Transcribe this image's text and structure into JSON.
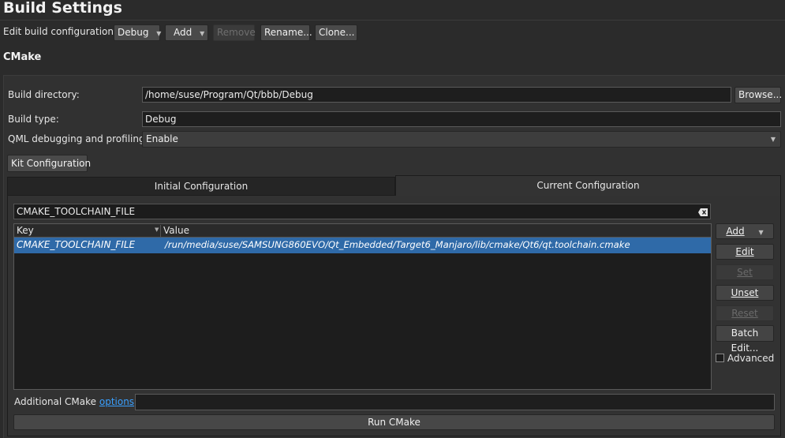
{
  "page_title": "Build Settings",
  "config_row": {
    "label": "Edit build configuration:",
    "config_value": "Debug",
    "add_label": "Add",
    "remove_label": "Remove",
    "rename_label": "Rename...",
    "clone_label": "Clone..."
  },
  "section_title": "CMake",
  "form": {
    "build_dir_label": "Build directory:",
    "build_dir_value": "/home/suse/Program/Qt/bbb/Debug",
    "browse_label": "Browse...",
    "build_type_label": "Build type:",
    "build_type_value": "Debug",
    "qml_label": "QML debugging and profiling:",
    "qml_value": "Enable",
    "kit_config_label": "Kit Configuration"
  },
  "tabs": [
    {
      "label": "Initial Configuration",
      "active": false
    },
    {
      "label": "Current Configuration",
      "active": true
    }
  ],
  "filter": {
    "value": "CMAKE_TOOLCHAIN_FILE"
  },
  "table": {
    "columns": [
      "Key",
      "Value"
    ],
    "rows": [
      {
        "key": "CMAKE_TOOLCHAIN_FILE",
        "value": "/run/media/suse/SAMSUNG860EVO/Qt_Embedded/Target6_Manjaro/lib/cmake/Qt6/qt.toolchain.cmake",
        "selected": true
      }
    ]
  },
  "side_buttons": {
    "add": "Add",
    "edit": "Edit",
    "set": "Set",
    "unset": "Unset",
    "reset": "Reset",
    "batch_edit": "Batch Edit...",
    "advanced": "Advanced",
    "advanced_checked": false
  },
  "footer": {
    "additional_prefix": "Additional CMake ",
    "options_link": "options",
    "colon": ":",
    "additional_value": "",
    "run_label": "Run CMake"
  },
  "colors": {
    "selection": "#2f6aa8",
    "link": "#3aa0ff",
    "background": "#2b2b2b"
  }
}
